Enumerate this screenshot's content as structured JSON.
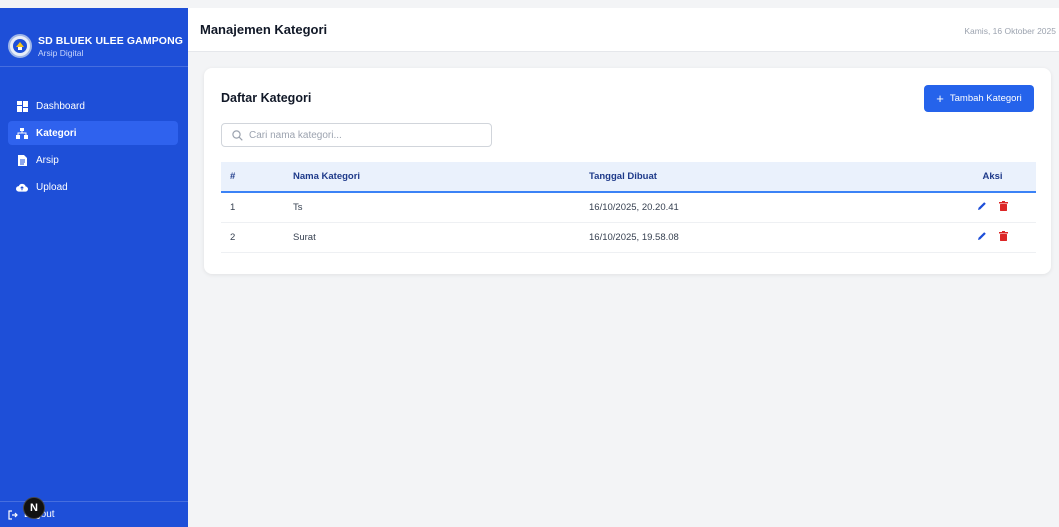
{
  "sidebar": {
    "brand_name": "SD BLUEK ULEE GAMPONG",
    "brand_sub": "Arsip Digital",
    "items": [
      {
        "label": "Dashboard",
        "icon": "dashboard-icon",
        "active": false
      },
      {
        "label": "Kategori",
        "icon": "sitemap-icon",
        "active": true
      },
      {
        "label": "Arsip",
        "icon": "file-icon",
        "active": false
      },
      {
        "label": "Upload",
        "icon": "cloud-upload-icon",
        "active": false
      }
    ],
    "logout_label": "Logout",
    "badge": "N"
  },
  "header": {
    "title": "Manajemen Kategori",
    "date": "Kamis, 16 Oktober 2025"
  },
  "card": {
    "title": "Daftar Kategori",
    "add_button": "Tambah Kategori",
    "search_placeholder": "Cari nama kategori..."
  },
  "table": {
    "headers": [
      "#",
      "Nama Kategori",
      "Tanggal Dibuat",
      "Aksi"
    ],
    "rows": [
      [
        "1",
        "Ts",
        "16/10/2025, 20.20.41"
      ],
      [
        "2",
        "Surat",
        "16/10/2025, 19.58.08"
      ]
    ]
  },
  "colors": {
    "sidebar": "#1e4fd8",
    "accent": "#2563eb",
    "edit": "#1d4ed8",
    "delete": "#dc2626"
  }
}
